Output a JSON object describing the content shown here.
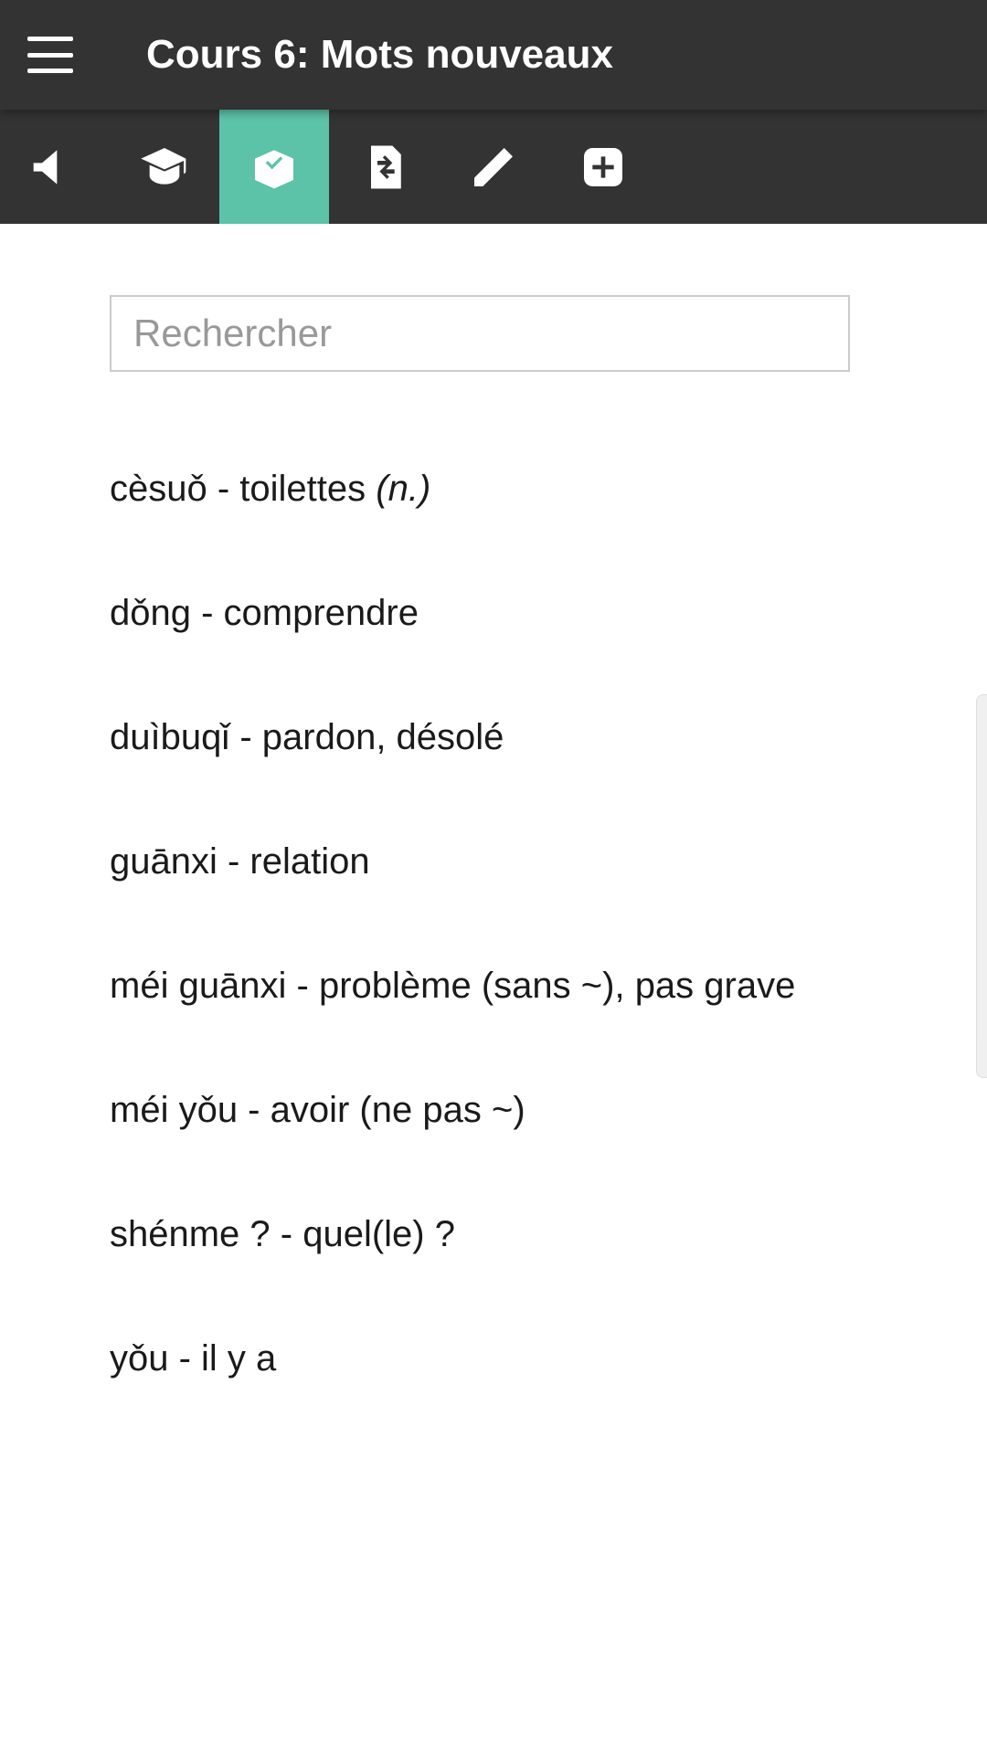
{
  "header": {
    "title": "Cours 6: Mots nouveaux"
  },
  "toolbar": {
    "items": [
      {
        "name": "megaphone-icon",
        "active": false
      },
      {
        "name": "graduation-cap-icon",
        "active": false
      },
      {
        "name": "box-icon",
        "active": true
      },
      {
        "name": "swap-file-icon",
        "active": false
      },
      {
        "name": "pencil-icon",
        "active": false
      },
      {
        "name": "add-icon",
        "active": false
      }
    ]
  },
  "search": {
    "placeholder": "Rechercher",
    "value": ""
  },
  "words": [
    {
      "pinyin": "cèsuǒ",
      "sep": " - ",
      "translation": "toilettes ",
      "pos": "(n.)"
    },
    {
      "pinyin": "dǒng",
      "sep": " - ",
      "translation": "comprendre",
      "pos": ""
    },
    {
      "pinyin": "duìbuqǐ",
      "sep": " - ",
      "translation": "pardon, désolé",
      "pos": ""
    },
    {
      "pinyin": "guānxi",
      "sep": " - ",
      "translation": "relation",
      "pos": ""
    },
    {
      "pinyin": "méi guānxi",
      "sep": " - ",
      "translation": "problème (sans ~), pas grave",
      "pos": ""
    },
    {
      "pinyin": "méi yǒu",
      "sep": " - ",
      "translation": "avoir (ne pas ~)",
      "pos": ""
    },
    {
      "pinyin": "shénme ?",
      "sep": " - ",
      "translation": "quel(le) ?",
      "pos": ""
    },
    {
      "pinyin": "yǒu",
      "sep": " - ",
      "translation": "il y a",
      "pos": ""
    }
  ]
}
